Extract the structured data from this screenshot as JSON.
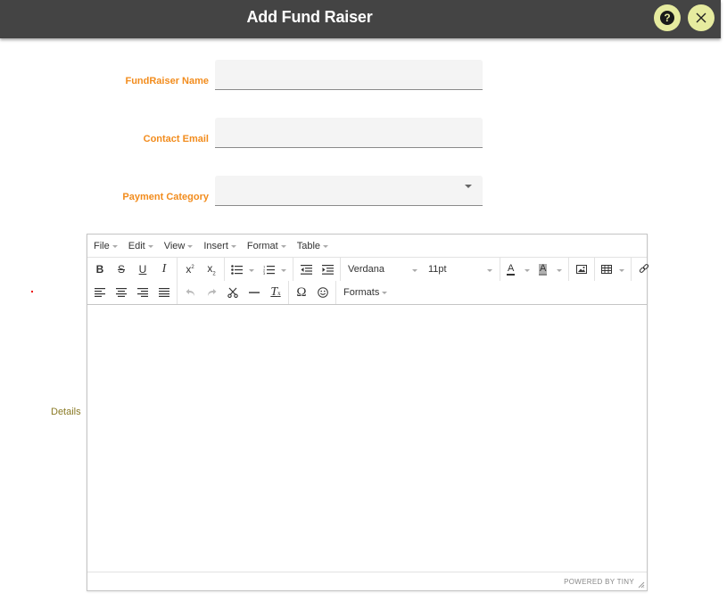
{
  "header": {
    "title": "Add Fund Raiser",
    "help_icon": "question-circle-icon",
    "close_icon": "close-x-icon",
    "accent_color": "#e6eb9f",
    "background_color": "#444444"
  },
  "form": {
    "label_color": "#f28c1d",
    "fields": [
      {
        "label": "FundRaiser Name",
        "value": "",
        "type": "text"
      },
      {
        "label": "Contact Email",
        "value": "",
        "type": "text"
      },
      {
        "label": "Payment Category",
        "value": "",
        "type": "select"
      }
    ],
    "details_label": "Details"
  },
  "editor": {
    "menubar": [
      "File",
      "Edit",
      "View",
      "Insert",
      "Format",
      "Table"
    ],
    "toolbar": {
      "row1": [
        [
          "bold-icon",
          "strikethrough-icon",
          "underline-icon",
          "italic-icon"
        ],
        [
          "superscript-icon",
          "subscript-icon"
        ],
        [
          "bullet-list-icon",
          "numbered-list-icon"
        ],
        [
          "outdent-icon",
          "indent-icon"
        ],
        [
          "font-family-select",
          "font-size-select"
        ],
        [
          "text-color-icon",
          "background-color-icon"
        ],
        [
          "image-icon"
        ],
        [
          "table-icon"
        ],
        [
          "link-icon"
        ]
      ],
      "row2": [
        [
          "align-left-icon",
          "align-center-icon",
          "align-right-icon",
          "align-justify-icon"
        ],
        [
          "undo-icon",
          "redo-icon",
          "cut-icon",
          "horizontal-rule-icon",
          "clear-formatting-icon"
        ],
        [
          "special-character-icon",
          "emoticons-icon"
        ],
        [
          "formats-select"
        ]
      ]
    },
    "font_family": "Verdana",
    "font_size": "11pt",
    "formats_label": "Formats",
    "content": "",
    "branding": "POWERED BY TINY"
  }
}
